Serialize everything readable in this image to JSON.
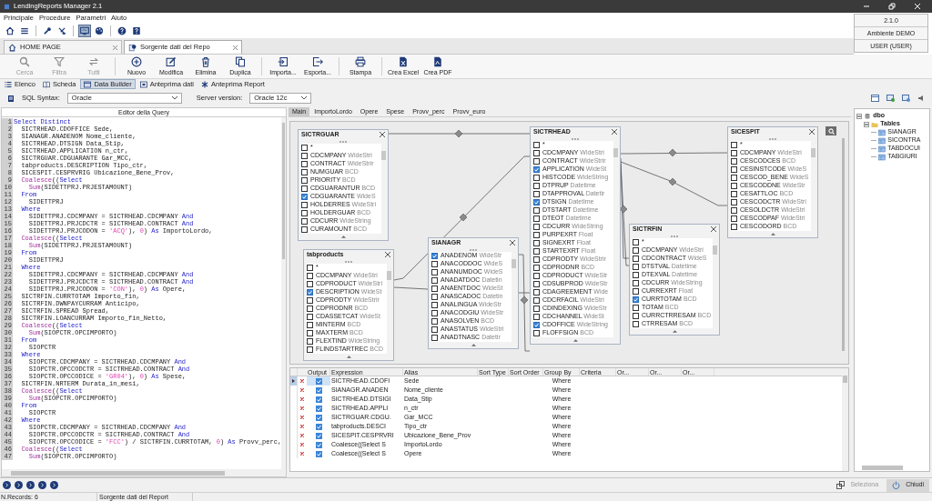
{
  "window": {
    "title": "LendingReports Manager 2.1"
  },
  "menu": [
    "Principale",
    "Procedure",
    "Parametri",
    "Aiuto"
  ],
  "quick_toolbar": [
    [
      {
        "kind": "home",
        "selected": false
      },
      {
        "kind": "menu",
        "selected": false
      }
    ],
    [
      {
        "kind": "wrench",
        "selected": false
      },
      {
        "kind": "tools",
        "selected": false
      }
    ],
    [
      {
        "kind": "screen",
        "selected": true
      },
      {
        "kind": "palette",
        "selected": false
      }
    ],
    [
      {
        "kind": "help",
        "selected": false
      },
      {
        "kind": "info",
        "selected": false
      }
    ]
  ],
  "info_panel": [
    "2.1.0",
    "Ambiente DEMO",
    "USER (USER)"
  ],
  "doc_tabs": [
    {
      "label": "HOME PAGE",
      "kind": "home",
      "selected": false
    },
    {
      "label": "Sorgente dati del Repo",
      "kind": "report",
      "selected": true
    }
  ],
  "toolbar": [
    [
      {
        "label": "Cerca",
        "kind": "search",
        "disabled": true
      },
      {
        "label": "Filtra",
        "kind": "filter",
        "disabled": true
      },
      {
        "label": "Tutti",
        "kind": "all",
        "disabled": true
      }
    ],
    [
      {
        "label": "Nuovo",
        "kind": "new",
        "disabled": false
      },
      {
        "label": "Modifica",
        "kind": "edit",
        "disabled": false
      },
      {
        "label": "Elimina",
        "kind": "delete",
        "disabled": false
      },
      {
        "label": "Duplica",
        "kind": "duplicate",
        "disabled": false
      }
    ],
    [
      {
        "label": "Importa...",
        "kind": "import",
        "disabled": false
      },
      {
        "label": "Esporta...",
        "kind": "export",
        "disabled": false
      }
    ],
    [
      {
        "label": "Stampa",
        "kind": "print",
        "disabled": false
      }
    ],
    [
      {
        "label": "Crea Excel",
        "kind": "excel",
        "disabled": false
      },
      {
        "label": "Crea PDF",
        "kind": "pdf",
        "disabled": false
      }
    ]
  ],
  "view_tabs": [
    {
      "label": "Elenco",
      "kind": "list",
      "selected": false
    },
    {
      "label": "Scheda",
      "kind": "card",
      "selected": false
    },
    {
      "label": "Data Builder",
      "kind": "builder",
      "selected": true
    },
    {
      "label": "Anteprima dati",
      "kind": "data",
      "selected": false
    },
    {
      "label": "Anteprima Report",
      "kind": "report",
      "selected": false
    }
  ],
  "sql_syntax": {
    "label": "SQL Syntax:",
    "value": "Oracle"
  },
  "server_version": {
    "label": "Server version:",
    "value": "Oracle 12c"
  },
  "editor": {
    "title": "Editor della Query",
    "lines": [
      {
        "number": "1",
        "parts": [
          {
            "kind": "keyword",
            "text": "Select Distinct"
          }
        ]
      },
      {
        "number": "2",
        "parts": [
          {
            "kind": "plain",
            "text": "  SICTRHEAD.CDOFFICE Sede,"
          }
        ]
      },
      {
        "number": "3",
        "parts": [
          {
            "kind": "plain",
            "text": "  SIANAGR.ANADENOM Nome_cliente,"
          }
        ]
      },
      {
        "number": "4",
        "parts": [
          {
            "kind": "plain",
            "text": "  SICTRHEAD.DTSIGN Data_Stip,"
          }
        ]
      },
      {
        "number": "5",
        "parts": [
          {
            "kind": "plain",
            "text": "  SICTRHEAD.APPLICATION n_ctr,"
          }
        ]
      },
      {
        "number": "6",
        "parts": [
          {
            "kind": "plain",
            "text": "  SICTRGUAR.CDGUARANTE Gar_MCC,"
          }
        ]
      },
      {
        "number": "7",
        "parts": [
          {
            "kind": "plain",
            "text": "  tabproducts.DESCRIPTION Tipo_ctr,"
          }
        ]
      },
      {
        "number": "8",
        "parts": [
          {
            "kind": "plain",
            "text": "  SICESPIT.CESPRVRIG Ubicazione_Bene_Prov,"
          }
        ]
      },
      {
        "number": "9",
        "parts": [
          {
            "kind": "function",
            "text": "  Coalesce"
          },
          {
            "kind": "plain",
            "text": "(("
          },
          {
            "kind": "keyword",
            "text": "Select"
          }
        ]
      },
      {
        "number": "10",
        "parts": [
          {
            "kind": "function",
            "text": "    Sum"
          },
          {
            "kind": "plain",
            "text": "(SIDETTPRJ.PRJESTAMOUNT)"
          }
        ]
      },
      {
        "number": "11",
        "parts": [
          {
            "kind": "keyword",
            "text": "  From"
          }
        ]
      },
      {
        "number": "12",
        "parts": [
          {
            "kind": "plain",
            "text": "    SIDETTPRJ"
          }
        ]
      },
      {
        "number": "13",
        "parts": [
          {
            "kind": "keyword",
            "text": "  Where"
          }
        ]
      },
      {
        "number": "14",
        "parts": [
          {
            "kind": "plain",
            "text": "    SIDETTPRJ.CDCMPANY = SICTRHEAD.CDCMPANY "
          },
          {
            "kind": "keyword",
            "text": "And"
          }
        ]
      },
      {
        "number": "15",
        "parts": [
          {
            "kind": "plain",
            "text": "    SIDETTPRJ.PRJCDCTR = SICTRHEAD.CONTRACT "
          },
          {
            "kind": "keyword",
            "text": "And"
          }
        ]
      },
      {
        "number": "16",
        "parts": [
          {
            "kind": "plain",
            "text": "    SIDETTPRJ.PRJCODON = "
          },
          {
            "kind": "string",
            "text": "'ACQ'"
          },
          {
            "kind": "plain",
            "text": "), "
          },
          {
            "kind": "number",
            "text": "0"
          },
          {
            "kind": "plain",
            "text": ") "
          },
          {
            "kind": "keyword",
            "text": "As"
          },
          {
            "kind": "plain",
            "text": " ImportoLordo,"
          }
        ]
      },
      {
        "number": "17",
        "parts": [
          {
            "kind": "function",
            "text": "  Coalesce"
          },
          {
            "kind": "plain",
            "text": "(("
          },
          {
            "kind": "keyword",
            "text": "Select"
          }
        ]
      },
      {
        "number": "18",
        "parts": [
          {
            "kind": "function",
            "text": "    Sum"
          },
          {
            "kind": "plain",
            "text": "(SIDETTPRJ.PRJESTAMOUNT)"
          }
        ]
      },
      {
        "number": "19",
        "parts": [
          {
            "kind": "keyword",
            "text": "  From"
          }
        ]
      },
      {
        "number": "20",
        "parts": [
          {
            "kind": "plain",
            "text": "    SIDETTPRJ"
          }
        ]
      },
      {
        "number": "21",
        "parts": [
          {
            "kind": "keyword",
            "text": "  Where"
          }
        ]
      },
      {
        "number": "22",
        "parts": [
          {
            "kind": "plain",
            "text": "    SIDETTPRJ.CDCMPANY = SICTRHEAD.CDCMPANY "
          },
          {
            "kind": "keyword",
            "text": "And"
          }
        ]
      },
      {
        "number": "23",
        "parts": [
          {
            "kind": "plain",
            "text": "    SIDETTPRJ.PRJCDCTR = SICTRHEAD.CONTRACT "
          },
          {
            "kind": "keyword",
            "text": "And"
          }
        ]
      },
      {
        "number": "24",
        "parts": [
          {
            "kind": "plain",
            "text": "    SIDETTPRJ.PRJCODON = "
          },
          {
            "kind": "string",
            "text": "'CON'"
          },
          {
            "kind": "plain",
            "text": "), "
          },
          {
            "kind": "number",
            "text": "0"
          },
          {
            "kind": "plain",
            "text": ") "
          },
          {
            "kind": "keyword",
            "text": "As"
          },
          {
            "kind": "plain",
            "text": " Opere,"
          }
        ]
      },
      {
        "number": "25",
        "parts": [
          {
            "kind": "plain",
            "text": "  SICTRFIN.CURRTOTAM Importo_fin,"
          }
        ]
      },
      {
        "number": "26",
        "parts": [
          {
            "kind": "plain",
            "text": "  SICTRFIN.DWNPAYCURRAM Anticipo,"
          }
        ]
      },
      {
        "number": "27",
        "parts": [
          {
            "kind": "plain",
            "text": "  SICTRFIN.SPREAD Spread,"
          }
        ]
      },
      {
        "number": "28",
        "parts": [
          {
            "kind": "plain",
            "text": "  SICTRFIN.LOANCURRAM Importo_fin_Netto,"
          }
        ]
      },
      {
        "number": "29",
        "parts": [
          {
            "kind": "function",
            "text": "  Coalesce"
          },
          {
            "kind": "plain",
            "text": "(("
          },
          {
            "kind": "keyword",
            "text": "Select"
          }
        ]
      },
      {
        "number": "30",
        "parts": [
          {
            "kind": "function",
            "text": "    Sum"
          },
          {
            "kind": "plain",
            "text": "(SIOPCTR.OPCIMPORTO)"
          }
        ]
      },
      {
        "number": "31",
        "parts": [
          {
            "kind": "keyword",
            "text": "  From"
          }
        ]
      },
      {
        "number": "32",
        "parts": [
          {
            "kind": "plain",
            "text": "    SIOPCTR"
          }
        ]
      },
      {
        "number": "33",
        "parts": [
          {
            "kind": "keyword",
            "text": "  Where"
          }
        ]
      },
      {
        "number": "34",
        "parts": [
          {
            "kind": "plain",
            "text": "    SIOPCTR.CDCMPANY = SICTRHEAD.CDCMPANY "
          },
          {
            "kind": "keyword",
            "text": "And"
          }
        ]
      },
      {
        "number": "35",
        "parts": [
          {
            "kind": "plain",
            "text": "    SIOPCTR.OPCCODCTR = SICTRHEAD.CONTRACT "
          },
          {
            "kind": "keyword",
            "text": "And"
          }
        ]
      },
      {
        "number": "36",
        "parts": [
          {
            "kind": "plain",
            "text": "    SIOPCTR.OPCCODICE = "
          },
          {
            "kind": "string",
            "text": "'GR04'"
          },
          {
            "kind": "plain",
            "text": "), "
          },
          {
            "kind": "number",
            "text": "0"
          },
          {
            "kind": "plain",
            "text": ") "
          },
          {
            "kind": "keyword",
            "text": "As"
          },
          {
            "kind": "plain",
            "text": " Spese,"
          }
        ]
      },
      {
        "number": "37",
        "parts": [
          {
            "kind": "plain",
            "text": "  SICTRFIN.NRTERM Durata_in_mesi,"
          }
        ]
      },
      {
        "number": "38",
        "parts": [
          {
            "kind": "function",
            "text": "  Coalesce"
          },
          {
            "kind": "plain",
            "text": "(("
          },
          {
            "kind": "keyword",
            "text": "Select"
          }
        ]
      },
      {
        "number": "39",
        "parts": [
          {
            "kind": "function",
            "text": "    Sum"
          },
          {
            "kind": "plain",
            "text": "(SIOPCTR.OPCIMPORTO)"
          }
        ]
      },
      {
        "number": "40",
        "parts": [
          {
            "kind": "keyword",
            "text": "  From"
          }
        ]
      },
      {
        "number": "41",
        "parts": [
          {
            "kind": "plain",
            "text": "    SIOPCTR"
          }
        ]
      },
      {
        "number": "42",
        "parts": [
          {
            "kind": "keyword",
            "text": "  Where"
          }
        ]
      },
      {
        "number": "43",
        "parts": [
          {
            "kind": "plain",
            "text": "    SIOPCTR.CDCMPANY = SICTRHEAD.CDCMPANY "
          },
          {
            "kind": "keyword",
            "text": "And"
          }
        ]
      },
      {
        "number": "44",
        "parts": [
          {
            "kind": "plain",
            "text": "    SIOPCTR.OPCCODCTR = SICTRHEAD.CONTRACT "
          },
          {
            "kind": "keyword",
            "text": "And"
          }
        ]
      },
      {
        "number": "45",
        "parts": [
          {
            "kind": "plain",
            "text": "    SIOPCTR.OPCCODICE = "
          },
          {
            "kind": "string",
            "text": "'FCC'"
          },
          {
            "kind": "plain",
            "text": ") / SICTRFIN.CURRTOTAM, "
          },
          {
            "kind": "number",
            "text": "0"
          },
          {
            "kind": "plain",
            "text": ") "
          },
          {
            "kind": "keyword",
            "text": "As"
          },
          {
            "kind": "plain",
            "text": " Provv_perc,"
          }
        ]
      },
      {
        "number": "46",
        "parts": [
          {
            "kind": "function",
            "text": "  Coalesce"
          },
          {
            "kind": "plain",
            "text": "(("
          },
          {
            "kind": "keyword",
            "text": "Select"
          }
        ]
      },
      {
        "number": "47",
        "parts": [
          {
            "kind": "function",
            "text": "    Sum"
          },
          {
            "kind": "plain",
            "text": "(SIOPCTR.OPCIMPORTO)"
          }
        ]
      }
    ]
  },
  "diagram_tabs": [
    {
      "label": "Main",
      "selected": true
    },
    {
      "label": "ImportoLordo",
      "selected": false
    },
    {
      "label": "Opere",
      "selected": false
    },
    {
      "label": "Spese",
      "selected": false
    },
    {
      "label": "Provv_perc",
      "selected": false
    },
    {
      "label": "Provv_euro",
      "selected": false
    }
  ],
  "tables": [
    {
      "name": "SICTRGUAR",
      "fields": [
        {
          "name": "*",
          "checked": false
        },
        {
          "name": "CDCMPANY",
          "type": "WideStri",
          "checked": false
        },
        {
          "name": "CONTRACT",
          "type": "WideStrir",
          "checked": false
        },
        {
          "name": "NUMGUAR",
          "type": "BCD",
          "checked": false
        },
        {
          "name": "PRIORITY",
          "type": "BCD",
          "checked": false
        },
        {
          "name": "CDGUARANTUR",
          "type": "BCD",
          "checked": false
        },
        {
          "name": "CDGUARANTE",
          "type": "WideS",
          "checked": true
        },
        {
          "name": "HOLDERRES",
          "type": "WideStri",
          "checked": false
        },
        {
          "name": "HOLDERGUAR",
          "type": "BCD",
          "checked": false
        },
        {
          "name": "CDCURR",
          "type": "WideString",
          "checked": false
        },
        {
          "name": "CURAMOUNT",
          "type": "BCD",
          "checked": false
        }
      ]
    },
    {
      "name": "tabproducts",
      "fields": [
        {
          "name": "*",
          "checked": false
        },
        {
          "name": "CDCMPANY",
          "type": "WideStri",
          "checked": false
        },
        {
          "name": "CDPRODUCT",
          "type": "WideStri",
          "checked": false
        },
        {
          "name": "DESCRIPTION",
          "type": "WideSt",
          "checked": true
        },
        {
          "name": "CDPRODTY",
          "type": "WideStrir",
          "checked": false
        },
        {
          "name": "CDPRODNR",
          "type": "BCD",
          "checked": false
        },
        {
          "name": "CDASSETCAT",
          "type": "WideSt",
          "checked": false
        },
        {
          "name": "MINTERM",
          "type": "BCD",
          "checked": false
        },
        {
          "name": "MAXTERM",
          "type": "BCD",
          "checked": false
        },
        {
          "name": "FLEXTIND",
          "type": "WideString",
          "checked": false
        },
        {
          "name": "FLINDSTARTREC",
          "type": "BCD",
          "checked": false
        }
      ]
    },
    {
      "name": "SIANAGR",
      "fields": [
        {
          "name": "ANADENOM",
          "type": "WideStr",
          "checked": true
        },
        {
          "name": "ANACODDOC",
          "type": "WideS",
          "checked": false
        },
        {
          "name": "ANANUMDOC",
          "type": "WideS",
          "checked": false
        },
        {
          "name": "ANADATDOC",
          "type": "Datetin",
          "checked": false
        },
        {
          "name": "ANAENTDOC",
          "type": "WideSt",
          "checked": false
        },
        {
          "name": "ANASCADOC",
          "type": "Datetin",
          "checked": false
        },
        {
          "name": "ANALINGUA",
          "type": "WideStr",
          "checked": false
        },
        {
          "name": "ANACODGIU",
          "type": "WideStr",
          "checked": false
        },
        {
          "name": "ANASOLVEN",
          "type": "BCD",
          "checked": false
        },
        {
          "name": "ANASTATUS",
          "type": "WideStri",
          "checked": false
        },
        {
          "name": "ANADTNASC",
          "type": "Datetir",
          "checked": false
        }
      ]
    },
    {
      "name": "SICTRHEAD",
      "fields": [
        {
          "name": "*",
          "checked": false
        },
        {
          "name": "CDCMPANY",
          "type": "WideStri",
          "checked": false
        },
        {
          "name": "CONTRACT",
          "type": "WideStrir",
          "checked": false
        },
        {
          "name": "APPLICATION",
          "type": "WideSt",
          "checked": true
        },
        {
          "name": "HISTCODE",
          "type": "WideString",
          "checked": false
        },
        {
          "name": "DTPRUP",
          "type": "Datetime",
          "checked": false
        },
        {
          "name": "DTAPPROVAL",
          "type": "Datetir",
          "checked": false
        },
        {
          "name": "DTSIGN",
          "type": "Datetime",
          "checked": true
        },
        {
          "name": "DTSTART",
          "type": "Datetime",
          "checked": false
        },
        {
          "name": "DTEOT",
          "type": "Datetime",
          "checked": false
        },
        {
          "name": "CDCURR",
          "type": "WideString",
          "checked": false
        },
        {
          "name": "PURPEXRT",
          "type": "Float",
          "checked": false
        },
        {
          "name": "SIGNEXRT",
          "type": "Float",
          "checked": false
        },
        {
          "name": "STARTEXRT",
          "type": "Float",
          "checked": false
        },
        {
          "name": "CDPRODTY",
          "type": "WideStrir",
          "checked": false
        },
        {
          "name": "CDPRODNR",
          "type": "BCD",
          "checked": false
        },
        {
          "name": "CDPRODUCT",
          "type": "WideStr",
          "checked": false
        },
        {
          "name": "CDSUBPROD",
          "type": "WideStr",
          "checked": false
        },
        {
          "name": "CDAGREEMENT",
          "type": "Wide",
          "checked": false
        },
        {
          "name": "CDCRFACIL",
          "type": "WideStri",
          "checked": false
        },
        {
          "name": "CDINDEXING",
          "type": "WideStr",
          "checked": false
        },
        {
          "name": "CDCHANNEL",
          "type": "WideSt",
          "checked": false
        },
        {
          "name": "CDOFFICE",
          "type": "WideString",
          "checked": true
        },
        {
          "name": "FLOFFSIGN",
          "type": "BCD",
          "checked": false
        }
      ]
    },
    {
      "name": "SICESPIT",
      "fields": [
        {
          "name": "*",
          "checked": false
        },
        {
          "name": "CDCMPANY",
          "type": "WideStri",
          "checked": false
        },
        {
          "name": "CESCODCES",
          "type": "BCD",
          "checked": false
        },
        {
          "name": "CESINSTCODE",
          "type": "WideS",
          "checked": false
        },
        {
          "name": "CESCOD_BENE",
          "type": "WideS",
          "checked": false
        },
        {
          "name": "CESCODDNE",
          "type": "WideStr",
          "checked": false
        },
        {
          "name": "CESATTLOC",
          "type": "BCD",
          "checked": false
        },
        {
          "name": "CESCODCTR",
          "type": "WideStri",
          "checked": false
        },
        {
          "name": "CESOLDCTR",
          "type": "WideStri",
          "checked": false
        },
        {
          "name": "CESCODPAF",
          "type": "WideStri",
          "checked": false
        },
        {
          "name": "CESCODORD",
          "type": "BCD",
          "checked": false
        }
      ]
    },
    {
      "name": "SICTRFIN",
      "fields": [
        {
          "name": "*",
          "checked": false
        },
        {
          "name": "CDCMPANY",
          "type": "WideStri",
          "checked": false
        },
        {
          "name": "CDCONTRACT",
          "type": "WideS",
          "checked": false
        },
        {
          "name": "DTSTVAL",
          "type": "Datetime",
          "checked": false
        },
        {
          "name": "DTEXVAL",
          "type": "Datetime",
          "checked": false
        },
        {
          "name": "CDCURR",
          "type": "WideString",
          "checked": false
        },
        {
          "name": "CURREXRT",
          "type": "Float",
          "checked": false
        },
        {
          "name": "CURRTOTAM",
          "type": "BCD",
          "checked": true
        },
        {
          "name": "TOTAM",
          "type": "BCD",
          "checked": false
        },
        {
          "name": "CURRCTRRESAM",
          "type": "BCD",
          "checked": false
        },
        {
          "name": "CTRRESAM",
          "type": "BCD",
          "checked": false
        }
      ]
    }
  ],
  "grid": {
    "columns": [
      "Output",
      "Expression",
      "Alias",
      "Sort Type",
      "Sort Order",
      "Group By",
      "Criteria",
      "Or...",
      "Or...",
      "Or..."
    ],
    "rows": [
      {
        "selected": true,
        "output": true,
        "expression": "SICTRHEAD.CDOFI",
        "alias": "Sede",
        "group_by": "Where"
      },
      {
        "selected": false,
        "output": true,
        "expression": "SIANAGR.ANADEN",
        "alias": "Nome_cliente",
        "group_by": "Where"
      },
      {
        "selected": false,
        "output": true,
        "expression": "SICTRHEAD.DTSIGI",
        "alias": "Data_Stip",
        "group_by": "Where"
      },
      {
        "selected": false,
        "output": true,
        "expression": "SICTRHEAD.APPLI",
        "alias": "n_ctr",
        "group_by": "Where"
      },
      {
        "selected": false,
        "output": true,
        "expression": "SICTRGUAR.CDGU.",
        "alias": "Gar_MCC",
        "group_by": "Where"
      },
      {
        "selected": false,
        "output": true,
        "expression": "tabproducts.DESCI",
        "alias": "Tipo_ctr",
        "group_by": "Where"
      },
      {
        "selected": false,
        "output": true,
        "expression": "SICESPIT.CESPRVRI",
        "alias": "Ubicazione_Bene_Prov",
        "group_by": "Where"
      },
      {
        "selected": false,
        "output": true,
        "expression": "Coalesce((Select S",
        "alias": "ImportoLordo",
        "group_by": "Where"
      },
      {
        "selected": false,
        "output": true,
        "expression": "Coalesce((Select S",
        "alias": "Opere",
        "group_by": "Where"
      }
    ]
  },
  "tree": {
    "label": "dbo",
    "kind": "schema",
    "expanded": true,
    "children": [
      {
        "label": "Tables",
        "kind": "folder",
        "expanded": true,
        "children": [
          {
            "label": "SIANAGR",
            "kind": "table"
          },
          {
            "label": "SICONTRA",
            "kind": "table"
          },
          {
            "label": "TABDOCUI",
            "kind": "table"
          },
          {
            "label": "TABGIURI",
            "kind": "table"
          }
        ]
      }
    ]
  },
  "footer_buttons": [
    {
      "label": "Seleziona",
      "kind": "select",
      "disabled": true
    },
    {
      "label": "Chiudi",
      "kind": "power",
      "disabled": false
    }
  ],
  "status_bar": [
    "N.Records: 6",
    "Sorgente dati del Report"
  ]
}
